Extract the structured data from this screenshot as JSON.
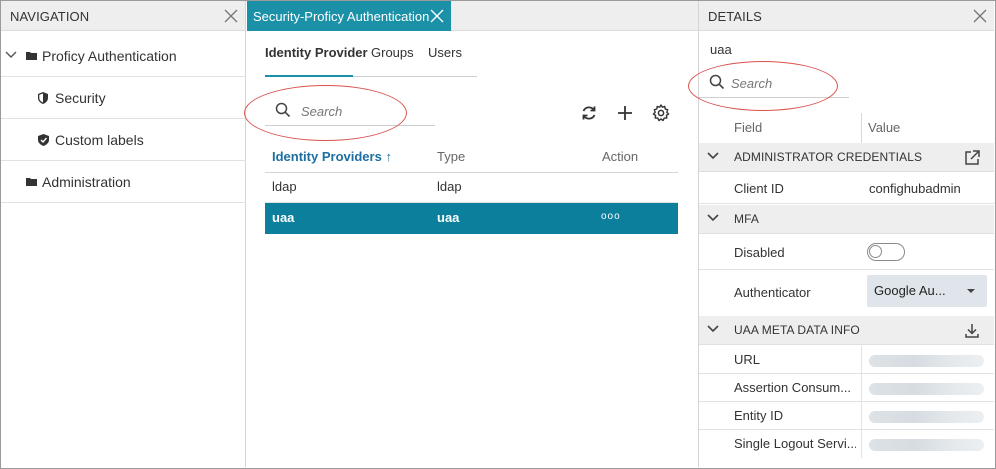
{
  "navigation": {
    "title": "NAVIGATION",
    "items": [
      {
        "label": "Proficy Authentication",
        "icon": "folder-icon",
        "expanded": true
      },
      {
        "label": "Security",
        "icon": "shield-icon"
      },
      {
        "label": "Custom labels",
        "icon": "shield-check-icon"
      },
      {
        "label": "Administration",
        "icon": "folder-icon"
      }
    ]
  },
  "center": {
    "tab_title": "Security-Proficy Authentication",
    "subtabs": [
      "Identity Provider",
      "Groups",
      "Users"
    ],
    "active_subtab": "Identity Provider",
    "search": {
      "placeholder": "Search"
    },
    "toolbar": [
      "refresh-icon",
      "add-icon",
      "settings-icon"
    ],
    "table": {
      "headers": [
        "Identity Providers",
        "Type",
        "Action"
      ],
      "sort_indicator": "↑",
      "rows": [
        {
          "name": "ldap",
          "type": "ldap",
          "action": ""
        },
        {
          "name": "uaa",
          "type": "uaa",
          "action": "ooo",
          "selected": true
        }
      ]
    }
  },
  "details": {
    "title": "DETAILS",
    "subtitle": "uaa",
    "search": {
      "placeholder": "Search"
    },
    "columns": [
      "Field",
      "Value"
    ],
    "sections": {
      "admin": {
        "title": "ADMINISTRATOR CREDENTIALS",
        "action_icon": "external-link-icon",
        "fields": [
          {
            "field": "Client ID",
            "value": "confighubadmin"
          }
        ]
      },
      "mfa": {
        "title": "MFA",
        "fields": [
          {
            "field": "Disabled",
            "control": "toggle",
            "on": false
          },
          {
            "field": "Authenticator",
            "control": "select",
            "value": "Google Au..."
          }
        ]
      },
      "meta": {
        "title": "UAA META DATA INFO",
        "action_icon": "download-icon",
        "fields": [
          {
            "field": "URL",
            "value_blurred": true
          },
          {
            "field": "Assertion Consum...",
            "value_blurred": true
          },
          {
            "field": "Entity ID",
            "value_blurred": true
          },
          {
            "field": "Single Logout Servi...",
            "value_blurred": true
          }
        ]
      }
    }
  },
  "colors": {
    "accent": "#1b91a8",
    "selected_row": "#0b7f9b",
    "header_bg": "#eeeeee",
    "callout": "#d9534f",
    "sorted_header": "#1d6fa3"
  }
}
